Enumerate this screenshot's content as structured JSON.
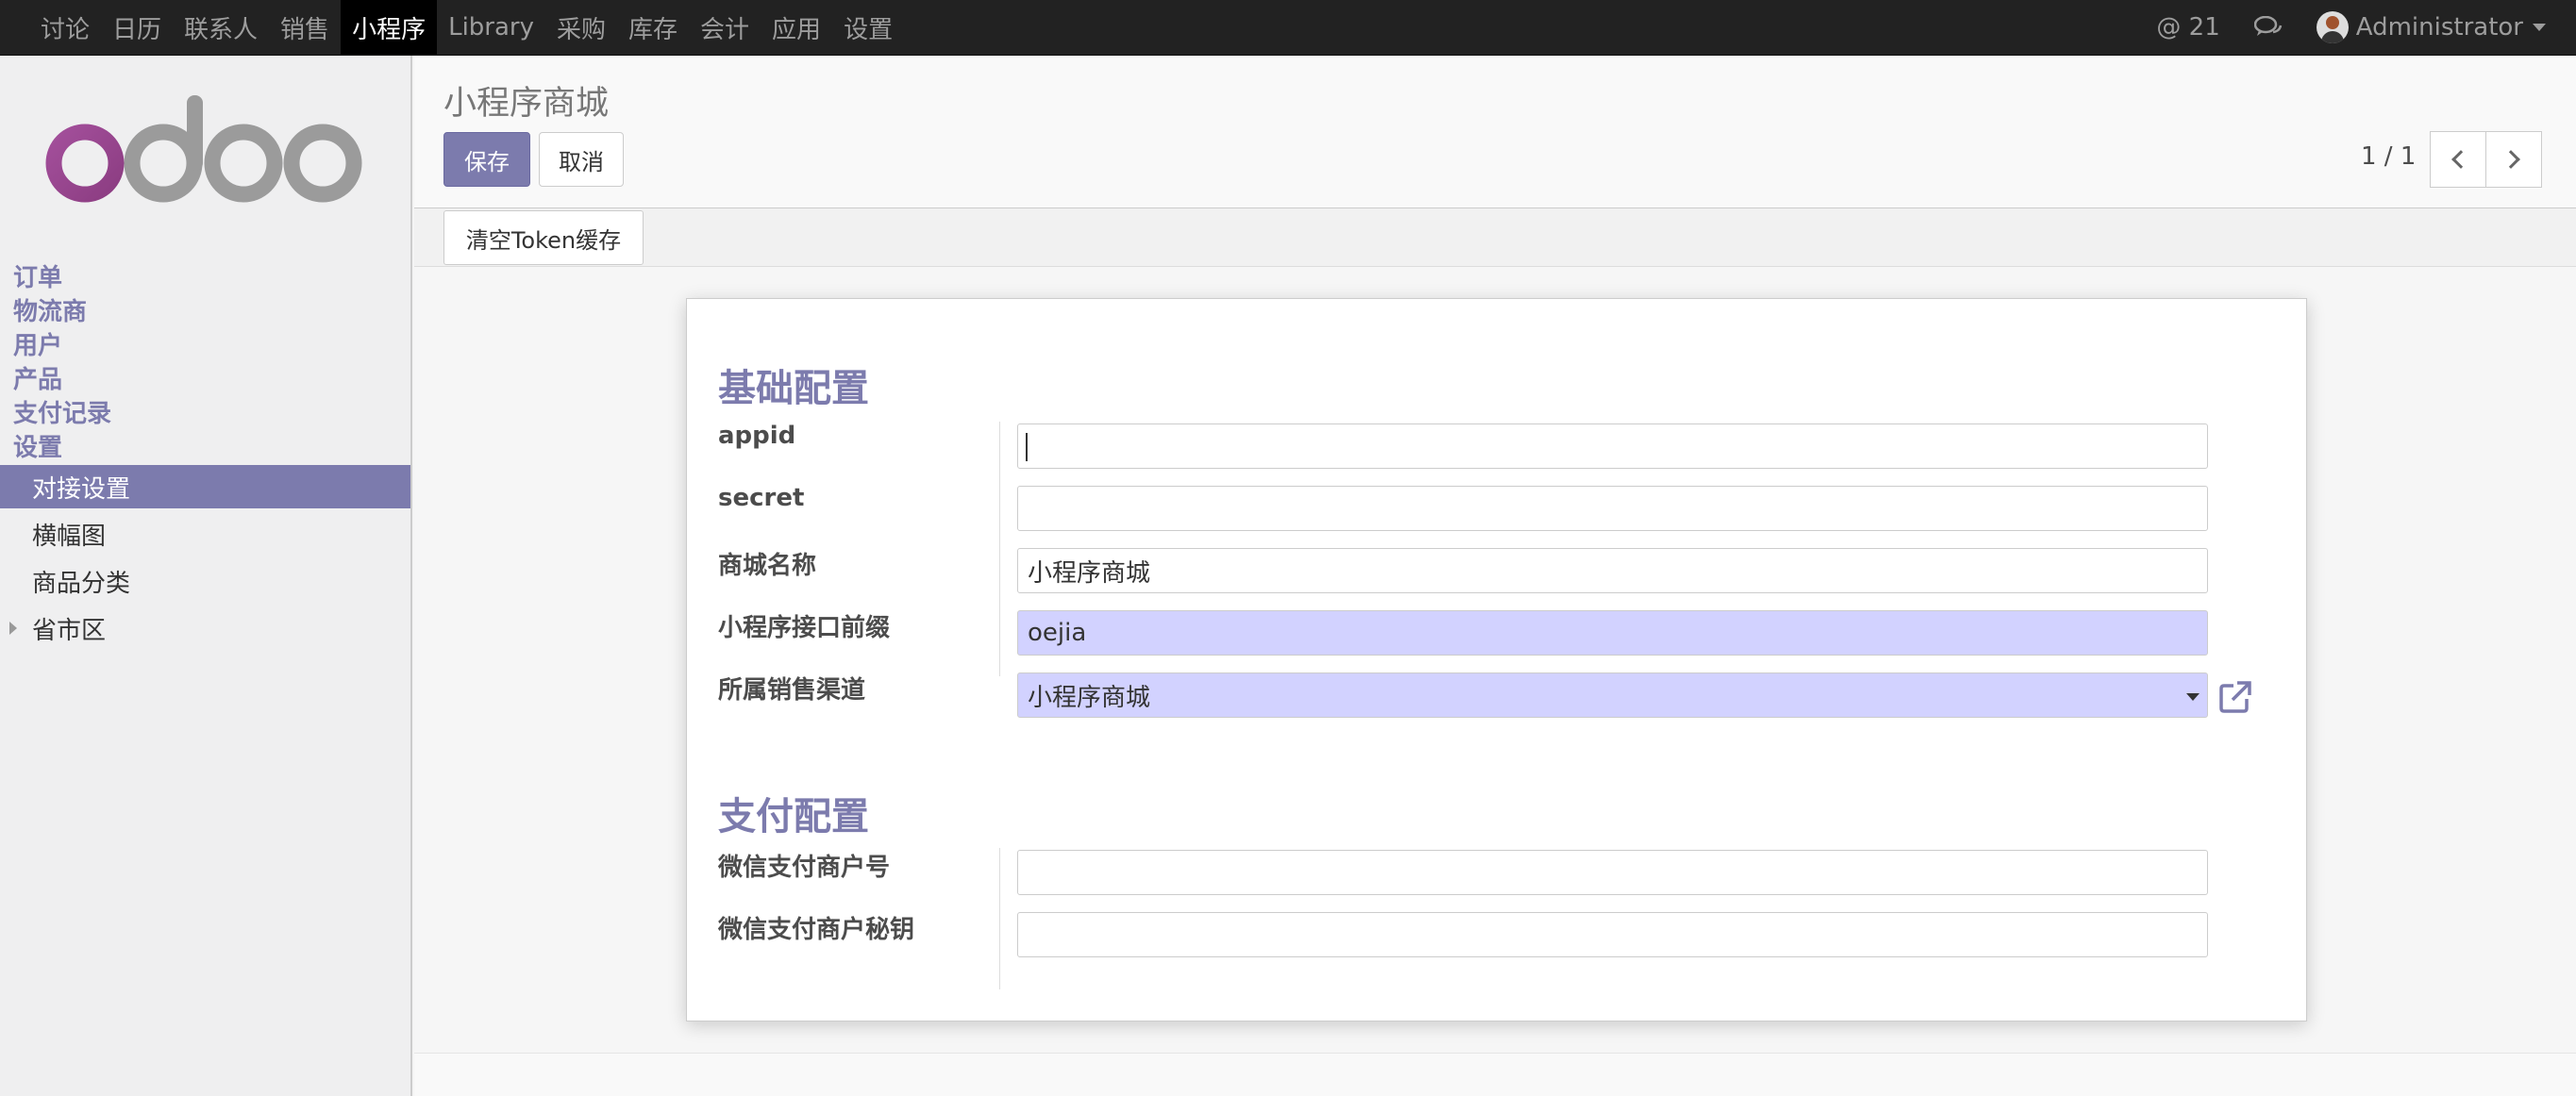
{
  "topnav": {
    "menu": [
      "讨论",
      "日历",
      "联系人",
      "销售",
      "小程序",
      "Library",
      "采购",
      "库存",
      "会计",
      "应用",
      "设置"
    ],
    "active_menu": "小程序",
    "mentions_count": "@ 21",
    "user_name": "Administrator"
  },
  "sidebar": {
    "logo_text": "odoo",
    "sections": [
      "订单",
      "物流商",
      "用户",
      "产品",
      "支付记录",
      "设置"
    ],
    "sub_items": [
      "对接设置",
      "横幅图",
      "商品分类",
      "省市区"
    ],
    "active_sub": "对接设置"
  },
  "control": {
    "breadcrumb": "小程序商城",
    "save_label": "保存",
    "cancel_label": "取消",
    "pager": "1 / 1"
  },
  "statusbar": {
    "clear_token_label": "清空Token缓存"
  },
  "form": {
    "basic_group_title": "基础配置",
    "pay_group_title": "支付配置",
    "fields": {
      "appid": {
        "label": "appid",
        "value": ""
      },
      "secret": {
        "label": "secret",
        "value": ""
      },
      "shop_name": {
        "label": "商城名称",
        "value": "小程序商城"
      },
      "api_prefix": {
        "label": "小程序接口前缀",
        "value": "oejia"
      },
      "sales_channel": {
        "label": "所属销售渠道",
        "value": "小程序商城"
      },
      "wx_mch_id": {
        "label": "微信支付商户号",
        "value": ""
      },
      "wx_mch_key": {
        "label": "微信支付商户秘钥",
        "value": ""
      }
    }
  },
  "colors": {
    "brand": "#7c7bad",
    "topbar": "#222222",
    "required_field": "#d2d2ff"
  },
  "icons": [
    "chat-icon",
    "avatar",
    "chevron-left-icon",
    "chevron-right-icon",
    "external-link-icon",
    "caret-down-icon",
    "caret-right-icon"
  ]
}
